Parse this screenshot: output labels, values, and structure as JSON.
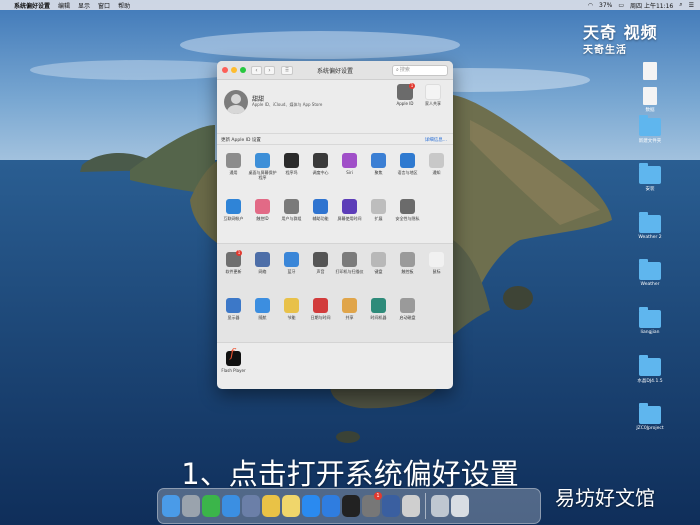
{
  "menubar": {
    "items": [
      "系统偏好设置",
      "编辑",
      "显示",
      "窗口",
      "帮助"
    ],
    "right_status": [
      "37%",
      "周四 上午11:16"
    ]
  },
  "watermark": {
    "line1": "天奇",
    "line2": "视频",
    "line3": "天奇生活"
  },
  "desktop_icons": [
    "",
    "",
    "数据",
    "",
    "新建文件夹",
    "安装",
    "Weather 2",
    "Weather",
    "liangjian",
    "水晶DJ4.1.5",
    "JZC0Jproject"
  ],
  "window": {
    "title": "系统偏好设置",
    "search_placeholder": "搜索",
    "nav_back": "‹",
    "nav_forward": "›",
    "grid_label": "⠿"
  },
  "account": {
    "name": "甜甜",
    "subtitle": "Apple ID、iCloud、媒体与 App Store",
    "apple_id_label": "Apple ID",
    "apple_id_badge": "1",
    "family_label": "家人共享"
  },
  "banner": {
    "left": "更新 Apple ID 设置",
    "right": "详细信息..."
  },
  "section1": {
    "rows": [
      [
        {
          "label": "通用",
          "color": "#8c8c8c"
        },
        {
          "label": "桌面与屏幕保护程序",
          "color": "#3d8fd8"
        },
        {
          "label": "程序坞",
          "color": "#2b2b2b"
        },
        {
          "label": "调度中心",
          "color": "#3a3a3a"
        },
        {
          "label": "Siri",
          "color": "#a04fc8"
        },
        {
          "label": "聚焦",
          "color": "#3b7fd4"
        },
        {
          "label": "语言与地区",
          "color": "#2f7ad0"
        },
        {
          "label": "通知",
          "color": "#c8c8c8"
        }
      ],
      [
        {
          "label": "互联网帐户",
          "color": "#2f84d7"
        },
        {
          "label": "触控ID",
          "color": "#e26a86"
        },
        {
          "label": "用户与群组",
          "color": "#7a7a7a"
        },
        {
          "label": "辅助功能",
          "color": "#2f74d0"
        },
        {
          "label": "屏幕使用时间",
          "color": "#5c3db8"
        },
        {
          "label": "扩展",
          "color": "#bdbdbd"
        },
        {
          "label": "安全性与隐私",
          "color": "#6b6b6b"
        }
      ]
    ]
  },
  "section2": {
    "rows": [
      [
        {
          "label": "软件更新",
          "color": "#6f6f6f",
          "badge": "1"
        },
        {
          "label": "网络",
          "color": "#4d6ea8"
        },
        {
          "label": "蓝牙",
          "color": "#3a86d8"
        },
        {
          "label": "声音",
          "color": "#555555"
        },
        {
          "label": "打印机与扫描仪",
          "color": "#7b7b7b"
        },
        {
          "label": "键盘",
          "color": "#b8b8b8"
        },
        {
          "label": "触控板",
          "color": "#9a9a9a"
        },
        {
          "label": "鼠标",
          "color": "#f1f1f1"
        }
      ],
      [
        {
          "label": "显示器",
          "color": "#3c78c8"
        },
        {
          "label": "随航",
          "color": "#3c8ee0"
        },
        {
          "label": "节能",
          "color": "#e8c14a"
        },
        {
          "label": "日期与时间",
          "color": "#d23c3c"
        },
        {
          "label": "共享",
          "color": "#e0a54a"
        },
        {
          "label": "时间机器",
          "color": "#2e8b7a"
        },
        {
          "label": "启动磁盘",
          "color": "#9a9a9a"
        }
      ]
    ]
  },
  "section3": {
    "items": [
      {
        "label": "Flash Player"
      }
    ]
  },
  "caption": "1、点击打开系统偏好设置",
  "brand": "易坊好文馆",
  "dock": {
    "items": [
      {
        "name": "finder",
        "color": "#4a9be8"
      },
      {
        "name": "launchpad",
        "color": "#9aa3ad"
      },
      {
        "name": "wechat",
        "color": "#3bb54a"
      },
      {
        "name": "safari",
        "color": "#3b8fe2"
      },
      {
        "name": "xcode-tools",
        "color": "#6b7fa8"
      },
      {
        "name": "photos",
        "color": "#e9c246"
      },
      {
        "name": "notes",
        "color": "#f0d66b"
      },
      {
        "name": "appstore",
        "color": "#2a8af0"
      },
      {
        "name": "upload",
        "color": "#2f7de0"
      },
      {
        "name": "terminal",
        "color": "#222222"
      },
      {
        "name": "system-preferences",
        "color": "#777777",
        "badge": "1"
      },
      {
        "name": "quicktime",
        "color": "#3a5fa0"
      },
      {
        "name": "sourcetree",
        "color": "#cfcfcf"
      },
      {
        "name": "preview",
        "color": "#bfc7d1"
      },
      {
        "name": "trash",
        "color": "#d8dde3"
      }
    ]
  }
}
